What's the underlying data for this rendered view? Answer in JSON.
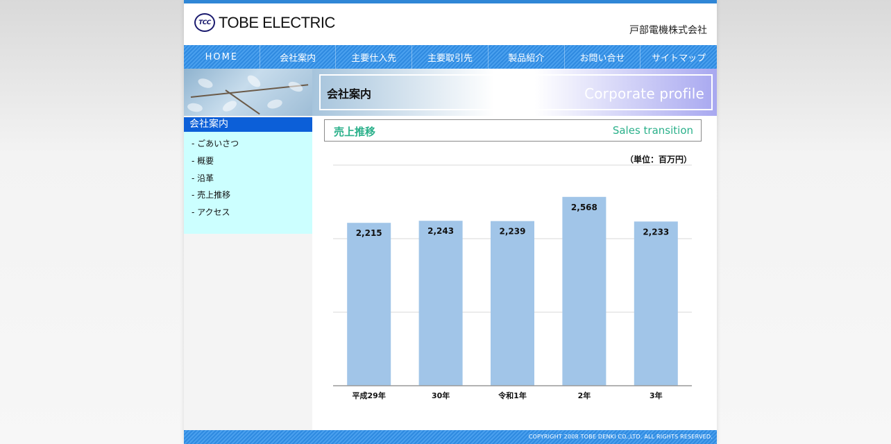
{
  "header": {
    "logo_mark": "TCC",
    "logo_text": "TOBE ELECTRIC",
    "company_jp": "戸部電機株式会社"
  },
  "nav": {
    "items": [
      {
        "label": "HOME"
      },
      {
        "label": "会社案内"
      },
      {
        "label": "主要仕入先"
      },
      {
        "label": "主要取引先"
      },
      {
        "label": "製品紹介"
      },
      {
        "label": "お問い合せ"
      },
      {
        "label": "サイトマップ"
      }
    ]
  },
  "page_title": {
    "jp": "会社案内",
    "en": "Corporate profile"
  },
  "sidebar": {
    "heading": "会社案内",
    "items": [
      {
        "label": "- ごあいさつ"
      },
      {
        "label": "- 概要"
      },
      {
        "label": "- 沿革"
      },
      {
        "label": "- 売上推移"
      },
      {
        "label": "- アクセス"
      }
    ]
  },
  "section": {
    "jp": "売上推移",
    "en": "Sales transition",
    "unit": "（単位：百万円）"
  },
  "chart_data": {
    "type": "bar",
    "categories": [
      "平成29年",
      "30年",
      "令和1年",
      "2年",
      "3年"
    ],
    "values": [
      2215,
      2243,
      2239,
      2568,
      2233
    ],
    "value_labels": [
      "2,215",
      "2,243",
      "2,239",
      "2,568",
      "2,233"
    ],
    "ylim": [
      0,
      3000
    ],
    "grid": true,
    "bar_color": "#a1c5e8"
  },
  "footer": {
    "copyright": "COPYRIGHT 2008 TOBE DENKI CO.,LTD. ALL RIGHTS RESERVED."
  },
  "colors": {
    "nav_blue": "#2f8ae0",
    "sidebar_heading": "#0c5fd8",
    "sidebar_bg": "#ccffff",
    "section_text": "#2ab08a"
  }
}
